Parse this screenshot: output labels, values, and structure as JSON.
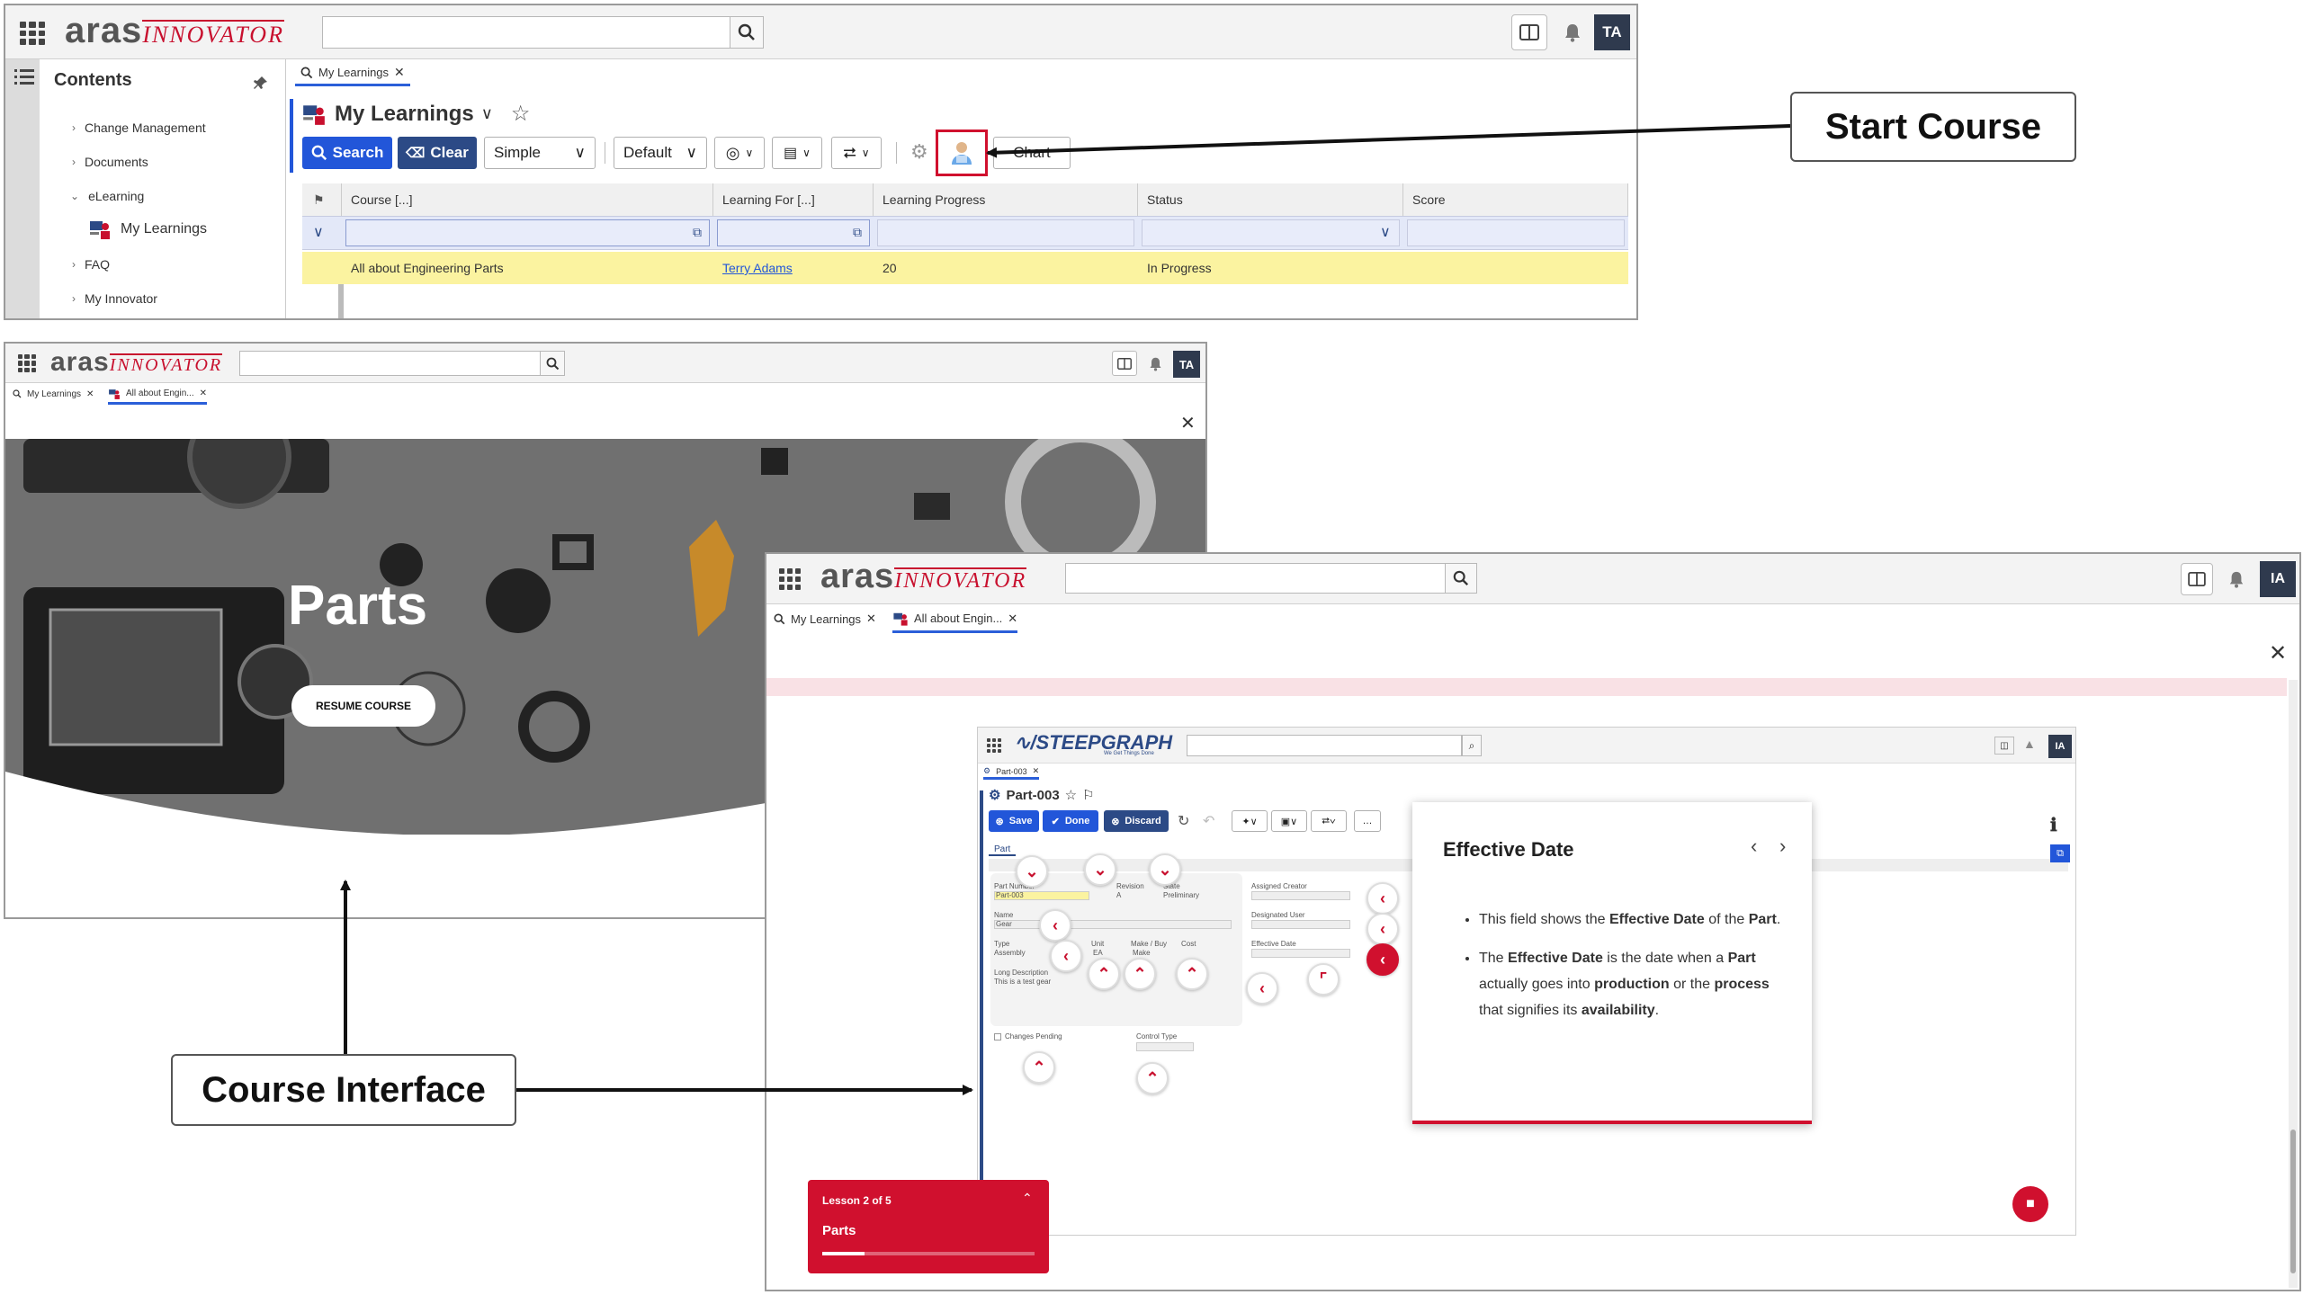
{
  "colors": {
    "accent": "#c8102e",
    "primary": "#2256d9",
    "highlight_row": "#fbf3a0",
    "filter_row": "#e3e8f8",
    "callout_border": "#555555"
  },
  "brand": {
    "word": "aras",
    "product": "INNOVATOR"
  },
  "callouts": {
    "start_course": "Start Course",
    "course_interface": "Course Interface"
  },
  "win1": {
    "avatar": "TA",
    "tab": "My Learnings",
    "sidebar": {
      "title": "Contents",
      "items": [
        {
          "label": "Change Management",
          "icon": "chevron-right-icon"
        },
        {
          "label": "Documents",
          "icon": "chevron-right-icon"
        },
        {
          "label": "eLearning",
          "icon": "chevron-down-icon"
        },
        {
          "label": "My Learnings",
          "icon": "learning-icon"
        },
        {
          "label": "FAQ",
          "icon": "chevron-right-icon"
        },
        {
          "label": "My Innovator",
          "icon": "chevron-right-icon"
        }
      ]
    },
    "page_title": "My Learnings",
    "toolbar": {
      "search": "Search",
      "clear": "Clear",
      "mode": "Simple",
      "view": "Default",
      "chart": "Chart"
    },
    "columns": [
      "Course [...]",
      "Learning For [...]",
      "Learning Progress",
      "Status",
      "Score"
    ],
    "rows": [
      {
        "course": "All about Engineering Parts",
        "learning_for": "Terry Adams",
        "progress": "20",
        "status": "In Progress",
        "score": ""
      }
    ]
  },
  "win2": {
    "avatar": "TA",
    "tabs": [
      "My Learnings",
      "All about Engin..."
    ],
    "hero_title": "Parts",
    "resume_button": "RESUME COURSE"
  },
  "win3": {
    "avatar": "IA",
    "tabs": [
      "My Learnings",
      "All about Engin..."
    ],
    "inner": {
      "brand": "STEEPGRAPH",
      "brand_sub": "We Get Things Done",
      "avatar": "IA",
      "tab": "Part-003",
      "item_title": "Part-003",
      "buttons": {
        "save": "Save",
        "done": "Done",
        "discard": "Discard"
      },
      "form_tab": "Part",
      "fields": {
        "part_number": "Part Number",
        "part_number_value": "Part-003",
        "revision": "Revision",
        "revision_value": "A",
        "state": "State",
        "state_value": "Preliminary",
        "assigned_creator": "Assigned Creator",
        "designated_user": "Designated User",
        "name": "Name",
        "name_value": "Gear",
        "type": "Type",
        "type_value": "Assembly",
        "unit": "Unit",
        "unit_value": "EA",
        "make_buy": "Make / Buy",
        "make_buy_value": "Make",
        "cost": "Cost",
        "effective_date": "Effective Date",
        "long_desc": "Long Description",
        "long_desc_value": "This is a test gear",
        "changes_pending": "Changes Pending",
        "control_type": "Control Type"
      }
    },
    "popup": {
      "title": "Effective Date",
      "bullets": [
        [
          {
            "t": "This field shows the ",
            "b": false
          },
          {
            "t": "Effective Date",
            "b": true
          },
          {
            "t": " of the ",
            "b": false
          },
          {
            "t": "Part",
            "b": true
          },
          {
            "t": ".",
            "b": false
          }
        ],
        [
          {
            "t": "The ",
            "b": false
          },
          {
            "t": "Effective Date",
            "b": true
          },
          {
            "t": " is the date when a ",
            "b": false
          },
          {
            "t": "Part",
            "b": true
          },
          {
            "t": " actually goes into ",
            "b": false
          },
          {
            "t": "production",
            "b": true
          },
          {
            "t": " or the ",
            "b": false
          },
          {
            "t": "process",
            "b": true
          },
          {
            "t": " that signifies its ",
            "b": false
          },
          {
            "t": "availability",
            "b": true
          },
          {
            "t": ".",
            "b": false
          }
        ]
      ]
    },
    "lesson": {
      "label": "Lesson 2 of 5",
      "name": "Parts",
      "progress": 0.2
    }
  }
}
